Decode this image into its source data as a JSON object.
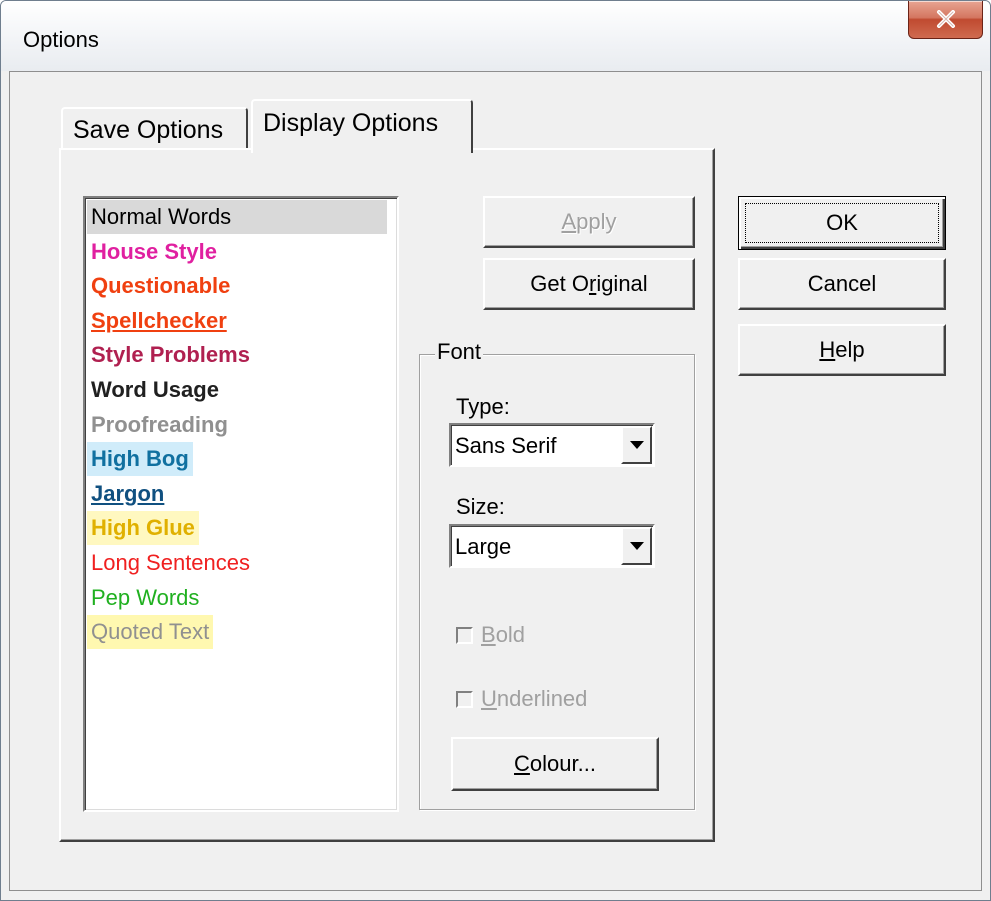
{
  "window": {
    "title": "Options",
    "close_label": "x"
  },
  "tabs": [
    {
      "label": "Save Options",
      "active": false
    },
    {
      "label": "Display Options",
      "active": true
    }
  ],
  "list": {
    "items": [
      {
        "label": "Normal Words",
        "color": "#000000",
        "bold": false,
        "underline": false,
        "highlight": "#d9d9d9",
        "selected": true
      },
      {
        "label": "House Style",
        "color": "#e020a0",
        "bold": true,
        "underline": false,
        "highlight": null
      },
      {
        "label": "Questionable",
        "color": "#f04010",
        "bold": true,
        "underline": false,
        "highlight": null
      },
      {
        "label": "Spellchecker",
        "color": "#f04010",
        "bold": true,
        "underline": true,
        "highlight": null
      },
      {
        "label": "Style Problems",
        "color": "#b02050",
        "bold": true,
        "underline": false,
        "highlight": null
      },
      {
        "label": "Word Usage",
        "color": "#202020",
        "bold": true,
        "underline": false,
        "highlight": null
      },
      {
        "label": "Proofreading",
        "color": "#909090",
        "bold": true,
        "underline": false,
        "highlight": null
      },
      {
        "label": "High Bog",
        "color": "#1070a0",
        "bold": true,
        "underline": false,
        "highlight": "#d0ecfa"
      },
      {
        "label": "Jargon",
        "color": "#105080",
        "bold": true,
        "underline": true,
        "highlight": null
      },
      {
        "label": "High Glue",
        "color": "#e0b000",
        "bold": true,
        "underline": false,
        "highlight": "#fff8c0"
      },
      {
        "label": "Long Sentences",
        "color": "#f02020",
        "bold": false,
        "underline": false,
        "highlight": null
      },
      {
        "label": "Pep Words",
        "color": "#20b020",
        "bold": false,
        "underline": false,
        "highlight": null
      },
      {
        "label": "Quoted Text",
        "color": "#909090",
        "bold": false,
        "underline": false,
        "highlight": "#fff8b0"
      }
    ]
  },
  "buttons": {
    "apply": {
      "before": "",
      "mnemonic": "A",
      "after": "pply"
    },
    "get_original": {
      "before": "Get O",
      "mnemonic": "r",
      "after": "iginal"
    },
    "ok": "OK",
    "cancel": "Cancel",
    "help": {
      "before": "",
      "mnemonic": "H",
      "after": "elp"
    },
    "colour": {
      "before": "",
      "mnemonic": "C",
      "after": "olour..."
    }
  },
  "font_group": {
    "label": "Font",
    "type_label": "Type:",
    "type_value": "Sans Serif",
    "size_label": "Size:",
    "size_value": "Large",
    "bold": {
      "before": "",
      "mnemonic": "B",
      "after": "old",
      "checked": false
    },
    "underlined": {
      "before": "",
      "mnemonic": "U",
      "after": "nderlined",
      "checked": false
    }
  }
}
